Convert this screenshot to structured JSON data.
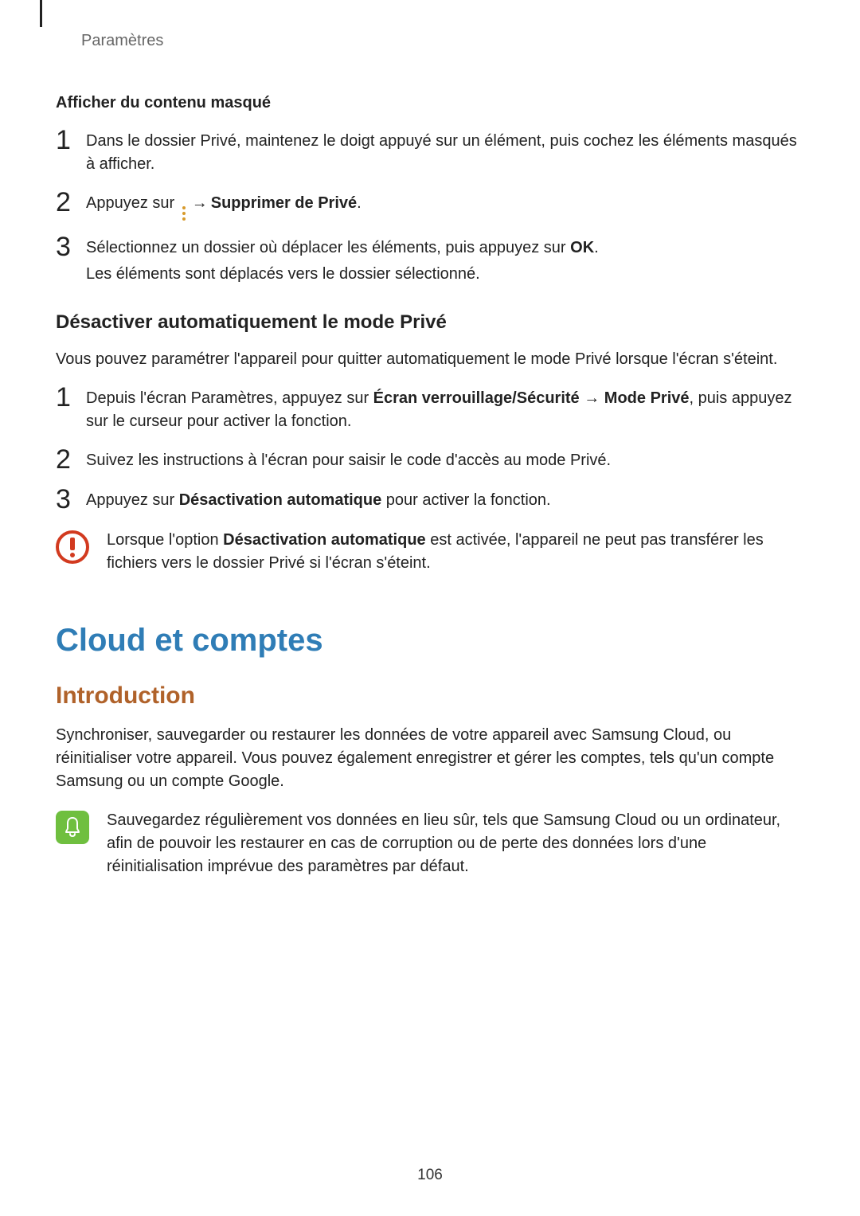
{
  "breadcrumb": "Paramètres",
  "section1": {
    "heading": "Afficher du contenu masqué",
    "step1": {
      "num": "1",
      "text": "Dans le dossier Privé, maintenez le doigt appuyé sur un élément, puis cochez les éléments masqués à afficher."
    },
    "step2": {
      "num": "2",
      "prefix": "Appuyez sur ",
      "arrow": "→",
      "bold": "Supprimer de Privé",
      "suffix": "."
    },
    "step3": {
      "num": "3",
      "line1_a": "Sélectionnez un dossier où déplacer les éléments, puis appuyez sur ",
      "line1_bold": "OK",
      "line1_b": ".",
      "line2": "Les éléments sont déplacés vers le dossier sélectionné."
    }
  },
  "section2": {
    "heading": "Désactiver automatiquement le mode Privé",
    "intro": "Vous pouvez paramétrer l'appareil pour quitter automatiquement le mode Privé lorsque l'écran s'éteint.",
    "step1": {
      "num": "1",
      "a": "Depuis l'écran Paramètres, appuyez sur ",
      "bold1": "Écran verrouillage/Sécurité",
      "arrow": " → ",
      "bold2": "Mode Privé",
      "b": ", puis appuyez sur le curseur pour activer la fonction."
    },
    "step2": {
      "num": "2",
      "text": "Suivez les instructions à l'écran pour saisir le code d'accès au mode Privé."
    },
    "step3": {
      "num": "3",
      "a": "Appuyez sur ",
      "bold": "Désactivation automatique",
      "b": " pour activer la fonction."
    },
    "callout": {
      "a": "Lorsque l'option ",
      "bold": "Désactivation automatique",
      "b": " est activée, l'appareil ne peut pas transférer les fichiers vers le dossier Privé si l'écran s'éteint."
    }
  },
  "section3": {
    "title": "Cloud et comptes",
    "sub": "Introduction",
    "intro": "Synchroniser, sauvegarder ou restaurer les données de votre appareil avec Samsung Cloud, ou réinitialiser votre appareil. Vous pouvez également enregistrer et gérer les comptes, tels qu'un compte Samsung ou un compte Google.",
    "callout": "Sauvegardez régulièrement vos données en lieu sûr, tels que Samsung Cloud ou un ordinateur, afin de pouvoir les restaurer en cas de corruption ou de perte des données lors d'une réinitialisation imprévue des paramètres par défaut."
  },
  "pageNumber": "106"
}
